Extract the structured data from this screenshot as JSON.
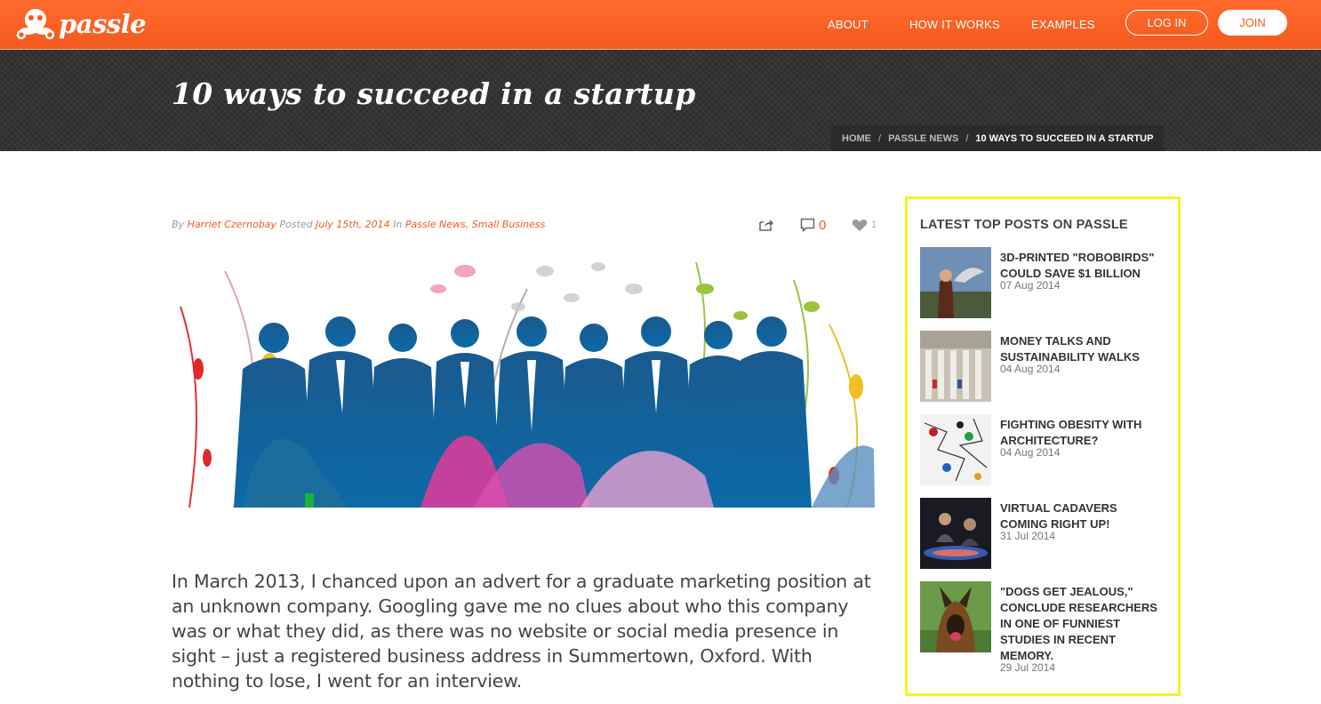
{
  "header": {
    "logo_text": "passle",
    "nav": [
      "ABOUT",
      "HOW IT WORKS",
      "EXAMPLES"
    ],
    "login_label": "LOG IN",
    "join_label": "JOIN",
    "brand_color": "#f45a1e"
  },
  "page": {
    "title": "10 ways to succeed in a startup",
    "breadcrumb": [
      "HOME",
      "PASSLE NEWS",
      "10 WAYS TO SUCCEED IN A STARTUP"
    ]
  },
  "post": {
    "by_label": "By",
    "author": "Harriet Czernobay",
    "posted_label": "Posted",
    "date": "July 15th, 2014",
    "in_label": "In",
    "categories": [
      "Passle News",
      "Small Business"
    ],
    "comment_count": "0",
    "like_count": "1",
    "body": "In March 2013, I chanced upon an advert for a graduate marketing position at an unknown company. Googling gave me no clues about who this company was or what they did, as there was no website or social media presence in sight – just a registered business address in Summertown, Oxford. With nothing to lose, I went for an interview."
  },
  "sidebar": {
    "title": "LATEST TOP POSTS ON PASSLE",
    "accent_color": "#f7f41e",
    "posts": [
      {
        "title": "3D-printed \"robobirds\" could save $1 billion",
        "date": "07 Aug 2014"
      },
      {
        "title": "Money Talks and Sustainability Walks",
        "date": "04 Aug 2014"
      },
      {
        "title": "Fighting obesity with architecture?",
        "date": "04 Aug 2014"
      },
      {
        "title": "Virtual cadavers coming right up!",
        "date": "31 Jul 2014"
      },
      {
        "title": "\"Dogs get jealous,\" conclude researchers in one of funniest studies in recent memory.",
        "date": "29 Jul 2014"
      }
    ]
  }
}
